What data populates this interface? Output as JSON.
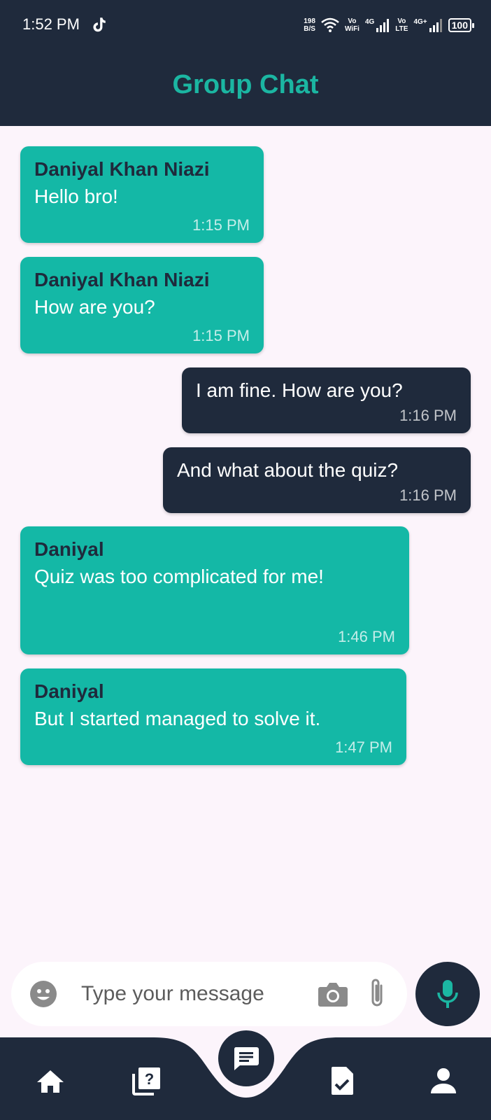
{
  "status_bar": {
    "time": "1:52 PM",
    "speed_value": "198",
    "speed_unit": "B/S",
    "wifi_label_top": "Vo",
    "wifi_label_bottom": "WiFi",
    "sim1_network": "4G",
    "sim2_label_top": "Vo",
    "sim2_label_bottom": "LTE",
    "sim2_network": "4G+",
    "battery": "100"
  },
  "header": {
    "title": "Group Chat"
  },
  "messages": [
    {
      "direction": "incoming",
      "sender": "Daniyal Khan Niazi",
      "text": "Hello bro!",
      "time": "1:15 PM"
    },
    {
      "direction": "incoming",
      "sender": "Daniyal Khan Niazi",
      "text": "How are you?",
      "time": "1:15 PM"
    },
    {
      "direction": "outgoing",
      "text": "I am fine. How are you?",
      "time": "1:16 PM"
    },
    {
      "direction": "outgoing",
      "text": "And what about the quiz?",
      "time": "1:16 PM"
    },
    {
      "direction": "incoming",
      "sender": "Daniyal",
      "text": "Quiz was too complicated for me!",
      "time": "1:46 PM"
    },
    {
      "direction": "incoming",
      "sender": "Daniyal",
      "text": "But I started managed to solve it.",
      "time": "1:47 PM"
    }
  ],
  "composer": {
    "placeholder": "Type your message",
    "value": ""
  },
  "icons": {
    "emoji": "emoji-icon",
    "camera": "camera-icon",
    "attach": "paperclip-icon",
    "mic": "microphone-icon",
    "home": "home-icon",
    "quiz": "quiz-icon",
    "chat": "chat-icon",
    "assignment": "assignment-check-icon",
    "profile": "person-icon"
  },
  "colors": {
    "header_bg": "#1f2a3c",
    "accent": "#1bb6a2",
    "incoming_bubble": "#14b8a6",
    "outgoing_bubble": "#1f2a3c",
    "page_bg": "#fcf4fb"
  },
  "bottom_nav": {
    "active": "chat"
  }
}
